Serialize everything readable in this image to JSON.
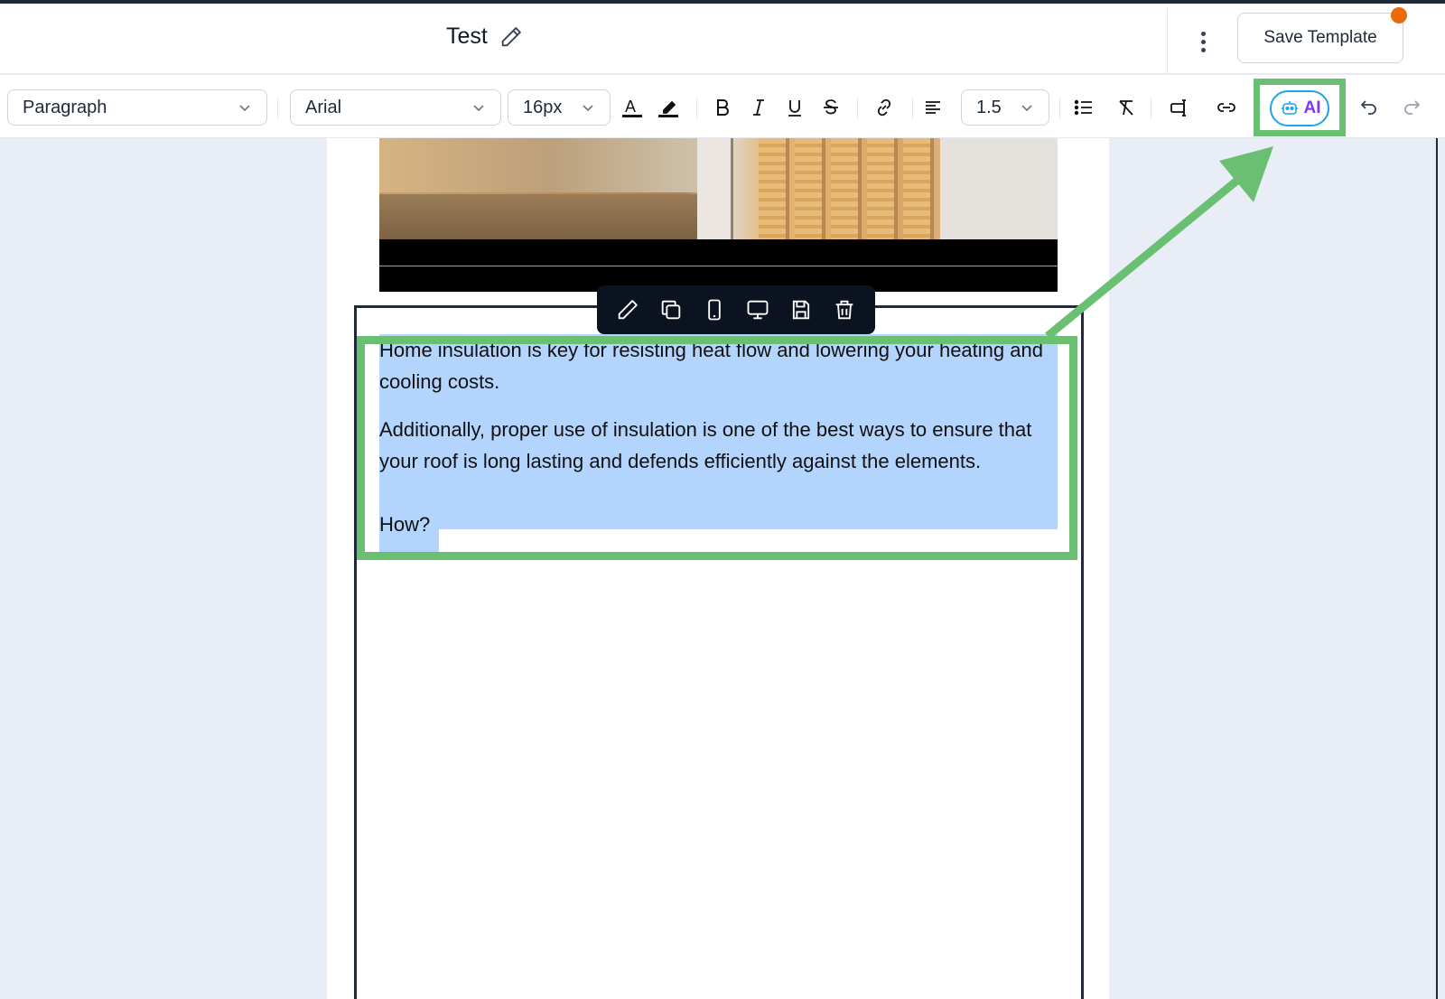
{
  "header": {
    "title": "Test",
    "save_label": "Save Template"
  },
  "toolbar": {
    "block_type": "Paragraph",
    "font_family": "Arial",
    "font_size": "16px",
    "line_height": "1.5",
    "ai_label": "AI"
  },
  "content": {
    "paragraphs": [
      "Home insulation is key for resisting heat flow and lowering your heating and cooling costs.",
      "Additionally, proper use of insulation is one of the best ways to ensure that your roof is long lasting and defends efficiently against the elements."
    ],
    "last_line": "How?"
  },
  "colors": {
    "highlight_green": "#6bbf73",
    "selection_blue": "#b3d4fc",
    "ai_accent": "#7c3aed",
    "notification": "#ea6a0c"
  },
  "icons": {
    "float_toolbar": [
      "pencil-icon",
      "duplicate-icon",
      "mobile-icon",
      "desktop-icon",
      "save-icon",
      "trash-icon"
    ]
  }
}
